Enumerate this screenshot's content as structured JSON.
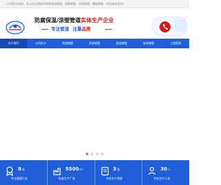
{
  "topbar": {
    "text": "...公司官方网站，本公司主营各种防腐保温钢管，防腐钢管，涂塑钢管，螺旋钢管，欢迎来电咨询！"
  },
  "header": {
    "slogan": {
      "prefix": "防腐保温/涂塑管道",
      "highlight": "实体生产企业",
      "focus": "专注管道",
      "quality_prefix": "注重",
      "quality": "品质"
    }
  },
  "nav": {
    "items": [
      {
        "label": "关于我们",
        "active": true
      },
      {
        "label": "公司实力",
        "active": false
      },
      {
        "label": "涂塑钢管",
        "active": false
      },
      {
        "label": "防腐钢管",
        "active": false
      },
      {
        "label": "保温钢管",
        "active": false
      },
      {
        "label": "新闻钢管",
        "active": false
      },
      {
        "label": "工程案例",
        "active": false
      }
    ]
  },
  "stats": [
    {
      "value": "8",
      "unit": "年",
      "label": "专注钢管行业"
    },
    {
      "value": "5500",
      "unit": "m²",
      "label": "标准生产厂房"
    },
    {
      "value": "3",
      "unit": "项",
      "label": "专业生产资质"
    },
    {
      "value": "30",
      "unit": "人",
      "label": "专业生产人员"
    }
  ],
  "colors": {
    "primary": "#1f5ed8",
    "primary_dark": "#1649b3",
    "accent_red": "#d8191a"
  }
}
